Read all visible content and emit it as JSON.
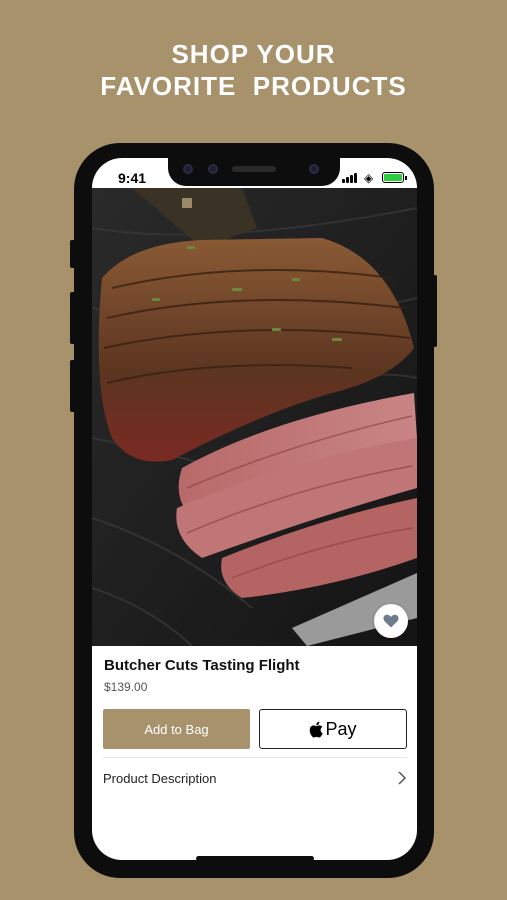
{
  "promo": {
    "headline_line1": "SHOP YOUR",
    "headline_line2": "FAVORITE  PRODUCTS"
  },
  "status_bar": {
    "time": "9:41"
  },
  "product": {
    "title": "Butcher Cuts Tasting Flight",
    "price": "$139.00",
    "favorite_icon": "heart-icon"
  },
  "actions": {
    "add_to_bag_label": "Add to Bag",
    "apple_pay_label": "Pay"
  },
  "details": {
    "description_label": "Product Description"
  },
  "colors": {
    "brand": "#a8926c",
    "background": "#a8926c",
    "phone_frame": "#0d0d0d"
  }
}
